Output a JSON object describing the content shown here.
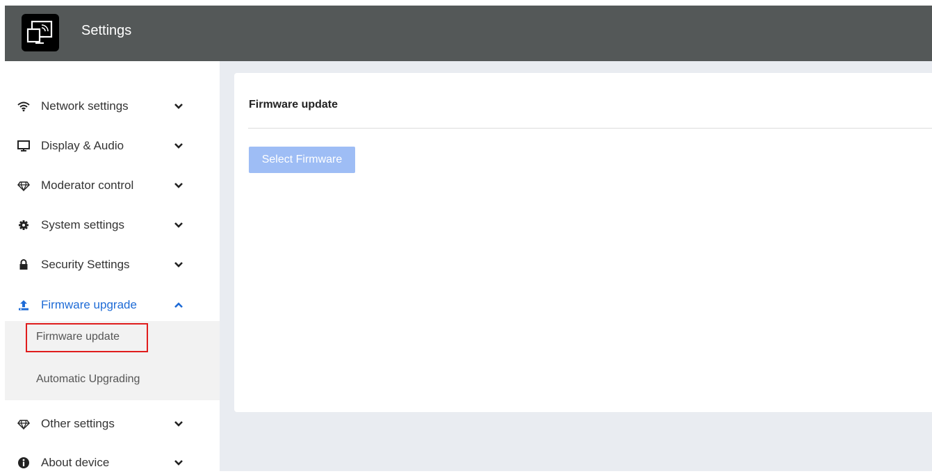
{
  "header": {
    "title": "Settings",
    "logo_icon": "screen-cast-icon",
    "background_color": "#545858"
  },
  "sidebar": {
    "accent_color": "#1e6bd6",
    "items": [
      {
        "label": "Network settings",
        "icon": "wifi-icon",
        "expanded": false
      },
      {
        "label": "Display & Audio",
        "icon": "monitor-icon",
        "expanded": false
      },
      {
        "label": "Moderator control",
        "icon": "diamond-icon",
        "expanded": false
      },
      {
        "label": "System settings",
        "icon": "gear-icon",
        "expanded": false
      },
      {
        "label": "Security Settings",
        "icon": "lock-icon",
        "expanded": false
      },
      {
        "label": "Firmware upgrade",
        "icon": "upload-icon",
        "expanded": true
      },
      {
        "label": "Other settings",
        "icon": "diamond-icon",
        "expanded": false
      },
      {
        "label": "About device",
        "icon": "info-icon",
        "expanded": false
      }
    ],
    "submenu": [
      {
        "label": "Firmware update",
        "selected": true
      },
      {
        "label": "Automatic Upgrading",
        "selected": false
      }
    ]
  },
  "main": {
    "card_title": "Firmware update",
    "select_button_label": "Select Firmware",
    "button_color": "#9ebdf5"
  }
}
